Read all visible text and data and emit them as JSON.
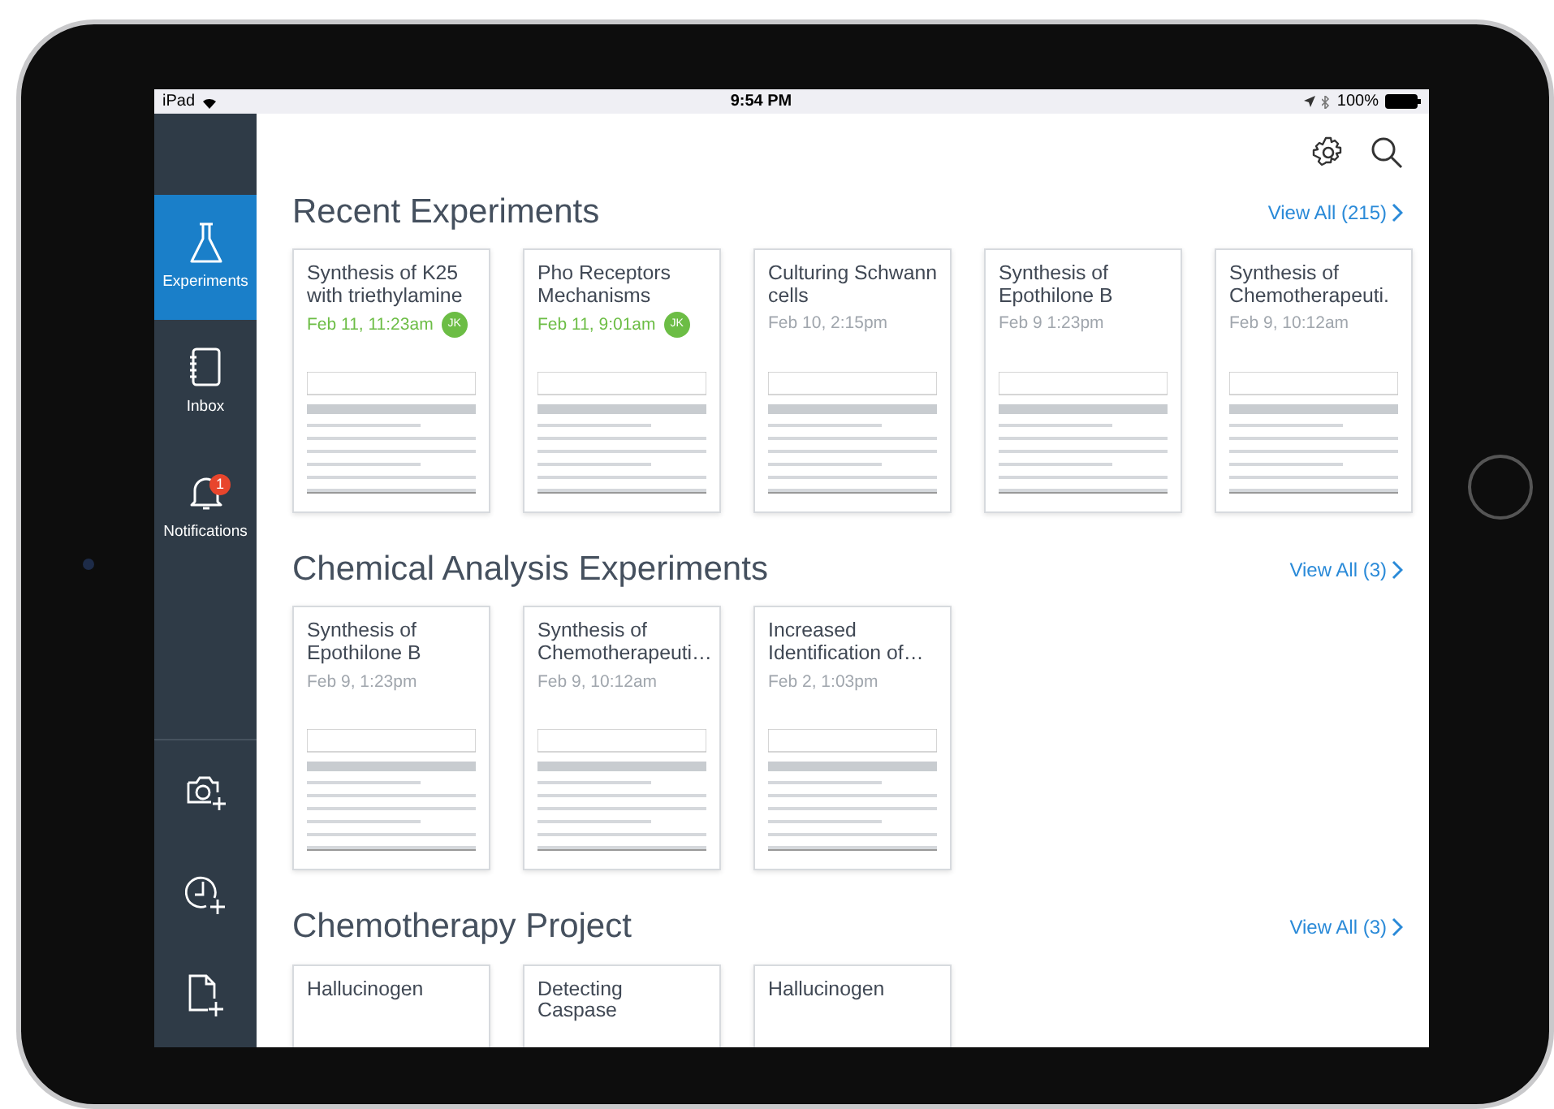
{
  "status_bar": {
    "device": "iPad",
    "time": "9:54 PM",
    "battery": "100%"
  },
  "sidebar": {
    "items": [
      {
        "label": "Experiments",
        "selected": true
      },
      {
        "label": "Inbox",
        "selected": false
      },
      {
        "label": "Notifications",
        "selected": false,
        "badge": "1"
      }
    ]
  },
  "sections": [
    {
      "title": "Recent Experiments",
      "view_all": "View All (215)",
      "cards": [
        {
          "title": "Synthesis of K25 with triethylamine",
          "date": "Feb 11, 11:23am",
          "author": "JK",
          "new": true
        },
        {
          "title": "Pho Receptors Mechanisms",
          "date": "Feb 11, 9:01am",
          "author": "JK",
          "new": true
        },
        {
          "title": "Culturing Schwann cells",
          "date": "Feb 10, 2:15pm",
          "new": false
        },
        {
          "title": "Synthesis of Epothilone B",
          "date": "Feb 9 1:23pm",
          "new": false
        },
        {
          "title": "Synthesis of Chemotherapeuti.",
          "date": "Feb 9, 10:12am",
          "new": false
        }
      ]
    },
    {
      "title": "Chemical Analysis Experiments",
      "view_all": "View All (3)",
      "cards": [
        {
          "title": "Synthesis of Epothilone B",
          "date": "Feb 9, 1:23pm",
          "new": false
        },
        {
          "title": "Synthesis of Chemotherapeuti…",
          "date": "Feb 9, 10:12am",
          "new": false
        },
        {
          "title": "Increased Identification of…",
          "date": "Feb 2, 1:03pm",
          "new": false
        }
      ]
    },
    {
      "title": "Chemotherapy Project",
      "view_all": "View All (3)",
      "cards": [
        {
          "title": "Hallucinogen"
        },
        {
          "title": "Detecting Caspase"
        },
        {
          "title": "Hallucinogen"
        }
      ]
    }
  ]
}
